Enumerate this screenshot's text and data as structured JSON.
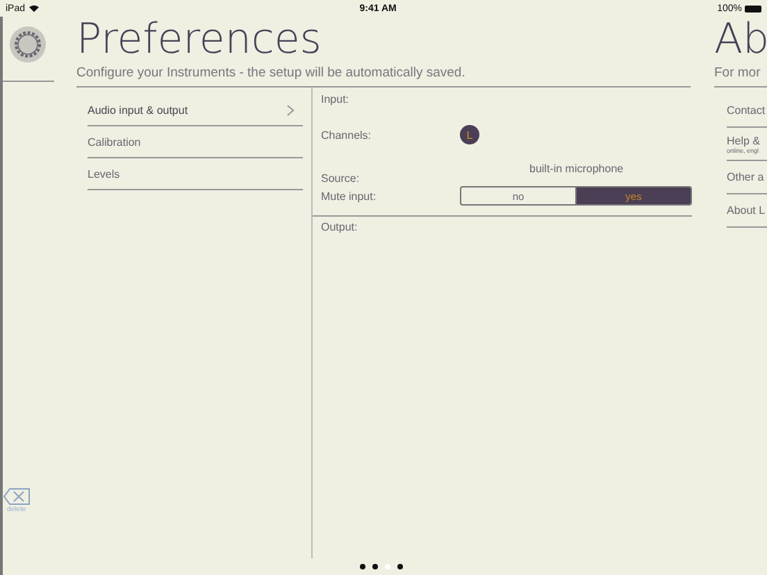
{
  "status_bar": {
    "device": "iPad",
    "time": "9:41 AM",
    "battery": "100%"
  },
  "preferences": {
    "title": "Preferences",
    "subtitle": "Configure your Instruments - the setup will be automatically saved.",
    "menu": [
      {
        "label": "Audio input & output",
        "selected": true
      },
      {
        "label": "Calibration",
        "selected": false
      },
      {
        "label": "Levels",
        "selected": false
      }
    ],
    "detail": {
      "input_heading": "Input:",
      "channels_label": "Channels:",
      "channels": [
        {
          "label": "L",
          "selected": true
        }
      ],
      "source_label": "Source:",
      "source_value": "built-in microphone",
      "mute_label": "Mute input:",
      "mute_options": [
        {
          "label": "no",
          "selected": false
        },
        {
          "label": "yes",
          "selected": true
        }
      ],
      "output_heading": "Output:"
    }
  },
  "about": {
    "title": "Ab",
    "subtitle": "For mor",
    "items": [
      {
        "label": "Contact"
      },
      {
        "label": "Help &",
        "sublabel": "online, engl"
      },
      {
        "label": "Other a"
      },
      {
        "label": "About L"
      }
    ]
  },
  "delete": {
    "label": "delete"
  },
  "page_dots": [
    {
      "selected": false
    },
    {
      "selected": false
    },
    {
      "selected": true
    },
    {
      "selected": false
    }
  ]
}
